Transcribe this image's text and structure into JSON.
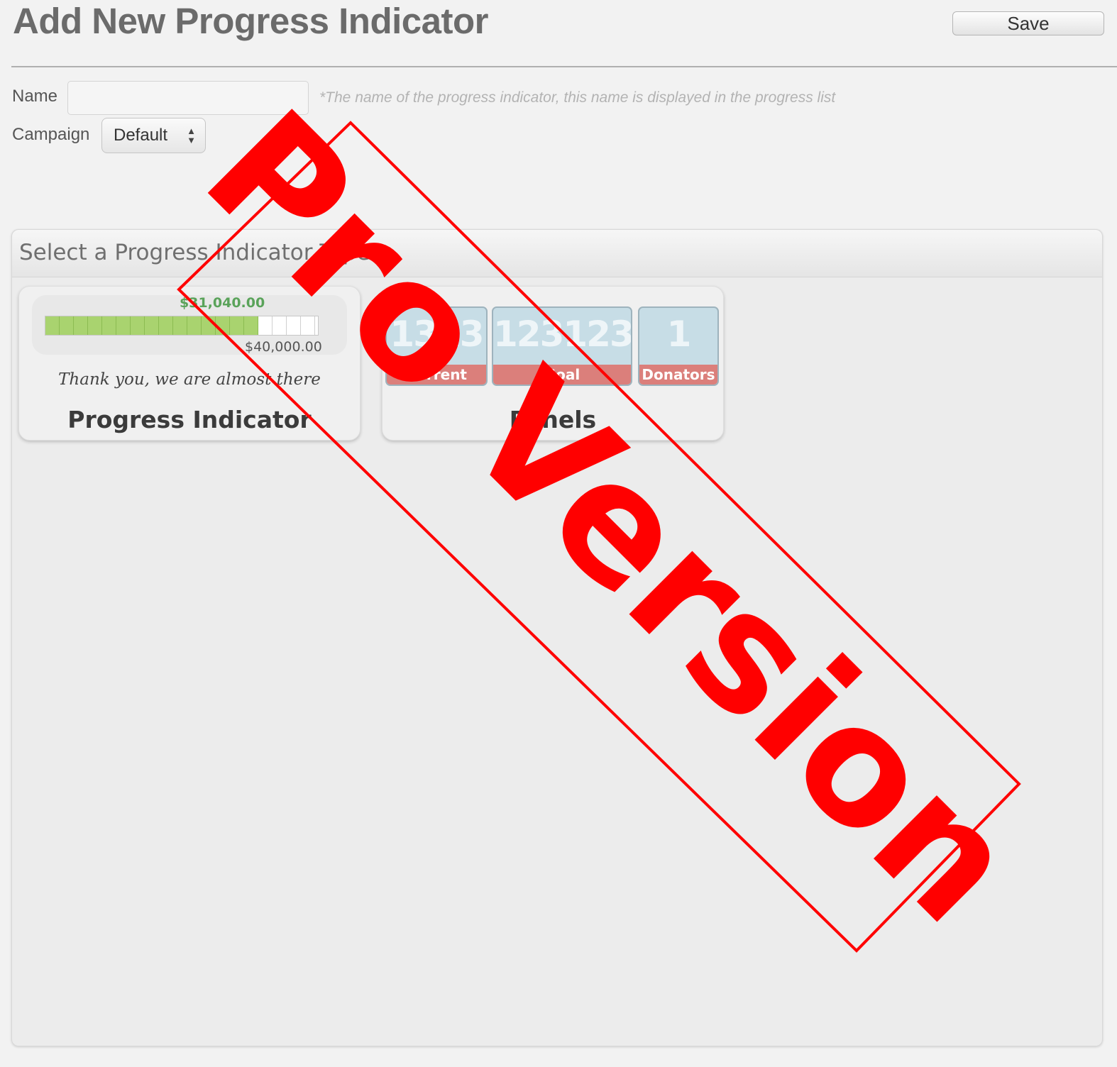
{
  "header": {
    "title": "Add New Progress Indicator",
    "save_label": "Save"
  },
  "form": {
    "name_label": "Name",
    "name_value": "",
    "name_hint": "*The name of the progress indicator, this name is displayed in the progress list",
    "campaign_label": "Campaign",
    "campaign_selected": "Default"
  },
  "panel": {
    "title": "Select a Progress Indicator Type",
    "types": [
      {
        "title": "Progress Indicator",
        "current": "$31,040.00",
        "goal": "$40,000.00",
        "progress_fraction": 0.78,
        "message": "Thank you, we are almost there"
      },
      {
        "title": "Panels",
        "tiles": [
          {
            "value": "1313",
            "label": "Current"
          },
          {
            "value": "123123",
            "label": "Goal"
          },
          {
            "value": "1",
            "label": "Donators"
          }
        ]
      }
    ]
  },
  "watermark": {
    "text": "Pro Version",
    "color": "#ff0000"
  },
  "colors": {
    "progress_fill": "#a9d36f",
    "tile_bg": "#c7dde6",
    "tile_label_bg": "#db7f7b",
    "current_text": "#5aa35a"
  }
}
